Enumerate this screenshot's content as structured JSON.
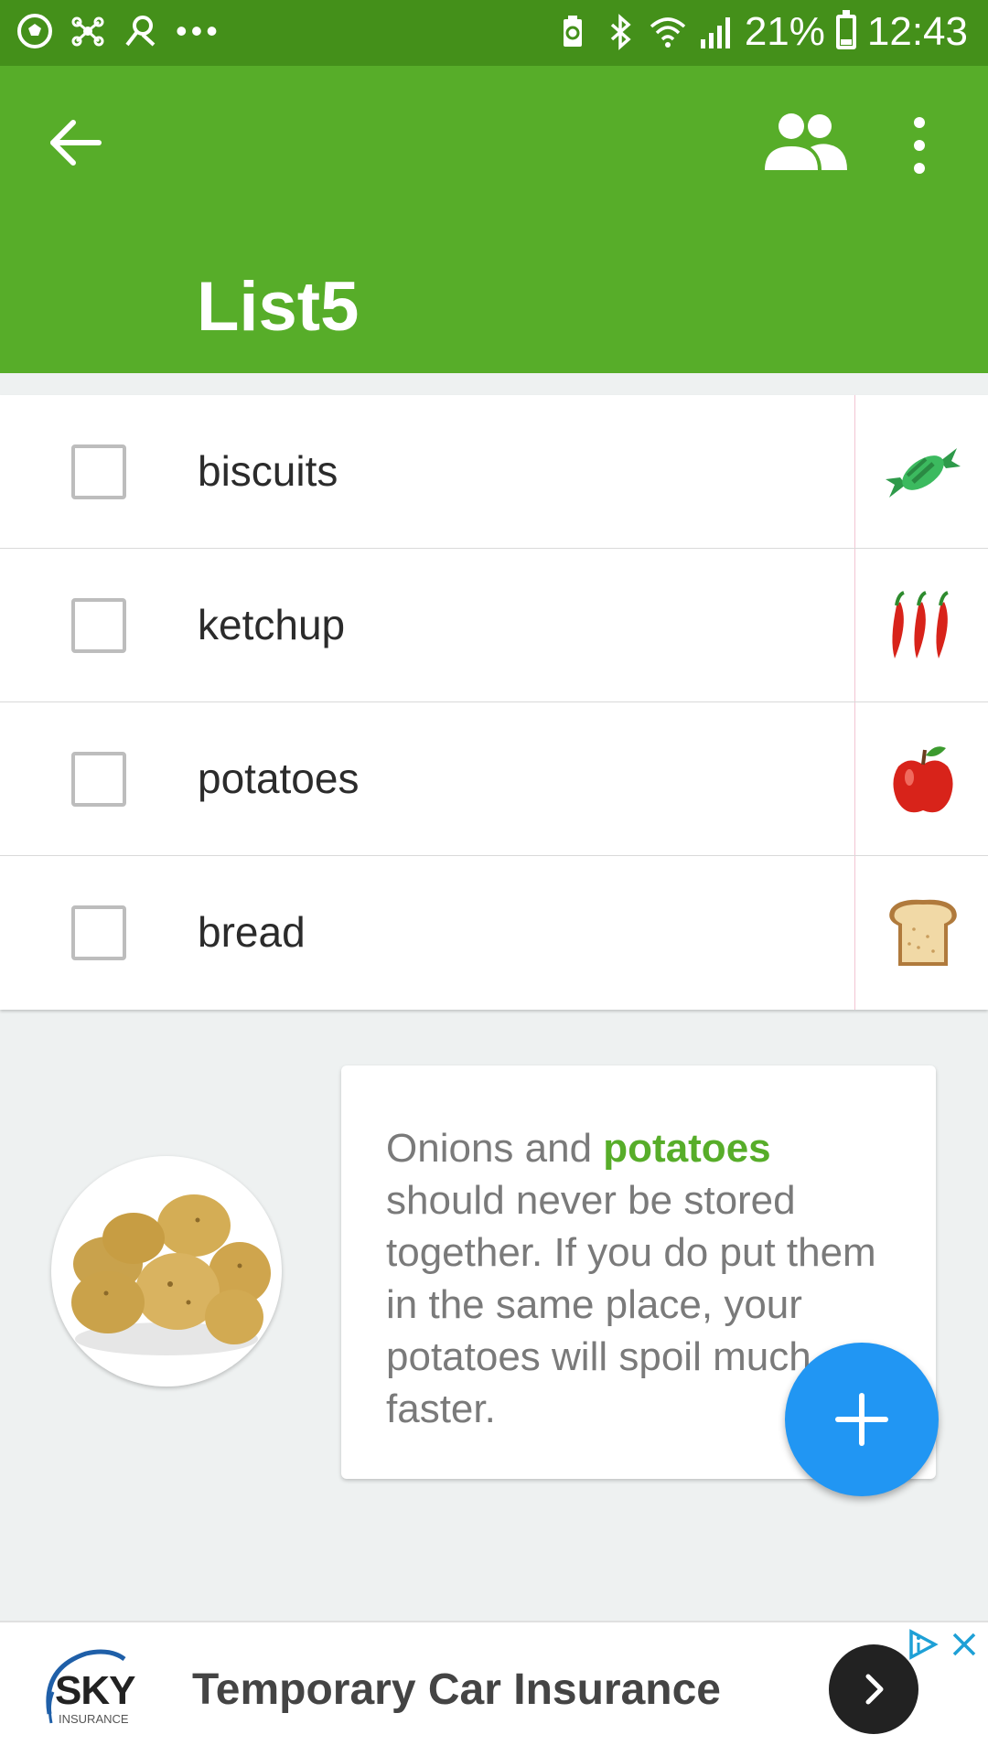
{
  "status_bar": {
    "battery_percent": "21%",
    "time": "12:43",
    "icons": [
      "soccer-ball-icon",
      "network-icon",
      "search-person-icon",
      "more-notifications-icon",
      "battery-saver-icon",
      "bluetooth-icon",
      "wifi-icon",
      "signal-icon",
      "battery-icon"
    ]
  },
  "app_bar": {
    "title": "List5",
    "icons": [
      "back-arrow-icon",
      "people-icon",
      "more-vert-icon"
    ],
    "color": "#57ad29"
  },
  "list": {
    "items": [
      {
        "label": "biscuits",
        "checked": false,
        "category_icon": "candy-icon"
      },
      {
        "label": "ketchup",
        "checked": false,
        "category_icon": "chili-peppers-icon"
      },
      {
        "label": "potatoes",
        "checked": false,
        "category_icon": "apple-icon"
      },
      {
        "label": "bread",
        "checked": false,
        "category_icon": "bread-icon"
      }
    ]
  },
  "tip": {
    "text_before": "Onions and ",
    "highlight": "potatoes",
    "text_after": " should never be stored together. If you do put them in the same place, your potatoes will spoil much faster.",
    "image": "potatoes-image",
    "highlight_color": "#57ad29"
  },
  "fab": {
    "icon": "plus-icon",
    "color": "#2196f3"
  },
  "ad": {
    "logo_text": "SKY",
    "logo_subtext": "INSURANCE",
    "headline": "Temporary Car Insurance",
    "icons": [
      "adchoices-icon",
      "close-icon",
      "chevron-right-icon"
    ]
  }
}
